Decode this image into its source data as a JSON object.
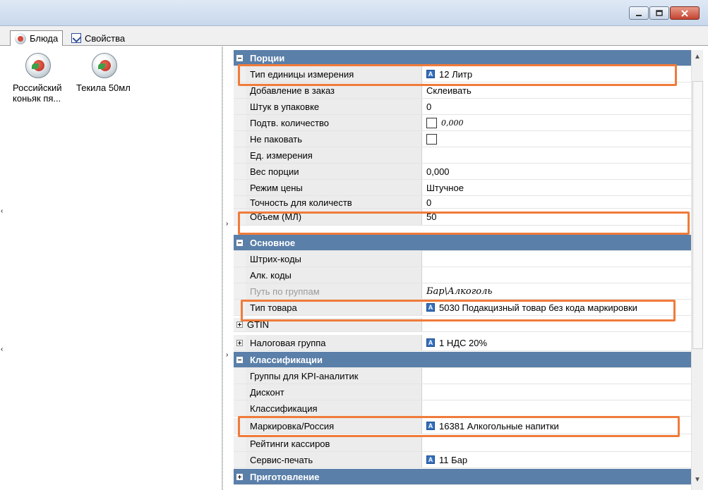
{
  "window": {
    "minimize_icon": "minimize-icon",
    "restore_icon": "restore-icon",
    "close_icon": "close-icon"
  },
  "tabs": [
    {
      "label": "Блюда",
      "icon": "dish-icon",
      "active": true
    },
    {
      "label": "Свойства",
      "icon": "properties-icon",
      "active": false
    }
  ],
  "dishes": [
    {
      "label_line1": "Российский",
      "label_line2": "коньяк пя..."
    },
    {
      "label_line1": "Текила 50мл",
      "label_line2": ""
    }
  ],
  "property_grid": {
    "sections": [
      {
        "title": "Порции",
        "expanded": true,
        "rows": [
          {
            "name": "Тип единицы измерения",
            "value": "12 Литр",
            "ref": true,
            "highlight": true
          },
          {
            "name": "Добавление в заказ",
            "value": "Склеивать"
          },
          {
            "name": "Штук в упаковке",
            "value": "0"
          },
          {
            "name": "Подтв. количество",
            "value": "0,000",
            "checkbox": true,
            "checked": false
          },
          {
            "name": "Не паковать",
            "value": "",
            "checkbox": true,
            "checked": false
          },
          {
            "name": "Ед. измерения",
            "value": ""
          },
          {
            "name": "Вес порции",
            "value": "0,000"
          },
          {
            "name": "Режим цены",
            "value": "Штучное"
          },
          {
            "name": "Точность для количеств",
            "value": "0"
          },
          {
            "name": "Объем (МЛ)",
            "value": "50",
            "highlight": true
          }
        ]
      },
      {
        "title": "Основное",
        "expanded": true,
        "rows": [
          {
            "name": "Штрих-коды",
            "value": ""
          },
          {
            "name": "Алк. коды",
            "value": ""
          },
          {
            "name": "Путь по группам",
            "value": "Бар\\Алкоголь",
            "dim": true
          },
          {
            "name": "Тип товара",
            "value": "5030 Подакцизный товар без кода маркировки",
            "ref": true,
            "highlight": true
          },
          {
            "name": "GTIN",
            "value": "",
            "expandable": true
          },
          {
            "name": "Налоговая группа",
            "value": "1 НДС 20%",
            "ref": true,
            "expandable": true
          }
        ]
      },
      {
        "title": "Классификации",
        "expanded": true,
        "rows": [
          {
            "name": "Группы для KPI-аналитик",
            "value": ""
          },
          {
            "name": "Дисконт",
            "value": ""
          },
          {
            "name": "Классификация",
            "value": ""
          },
          {
            "name": "Маркировка/Россия",
            "value": "16381 Алкогольные напитки",
            "ref": true,
            "highlight": true
          },
          {
            "name": "Рейтинги кассиров",
            "value": ""
          },
          {
            "name": "Сервис-печать",
            "value": "11 Бар",
            "ref": true
          }
        ]
      },
      {
        "title": "Приготовление",
        "expanded": false,
        "rows": []
      }
    ]
  },
  "ref_badge_letter": "A",
  "colors": {
    "category_bg": "#5a7fa9",
    "highlight": "#f07b3a",
    "ref_icon": "#3470bf"
  }
}
